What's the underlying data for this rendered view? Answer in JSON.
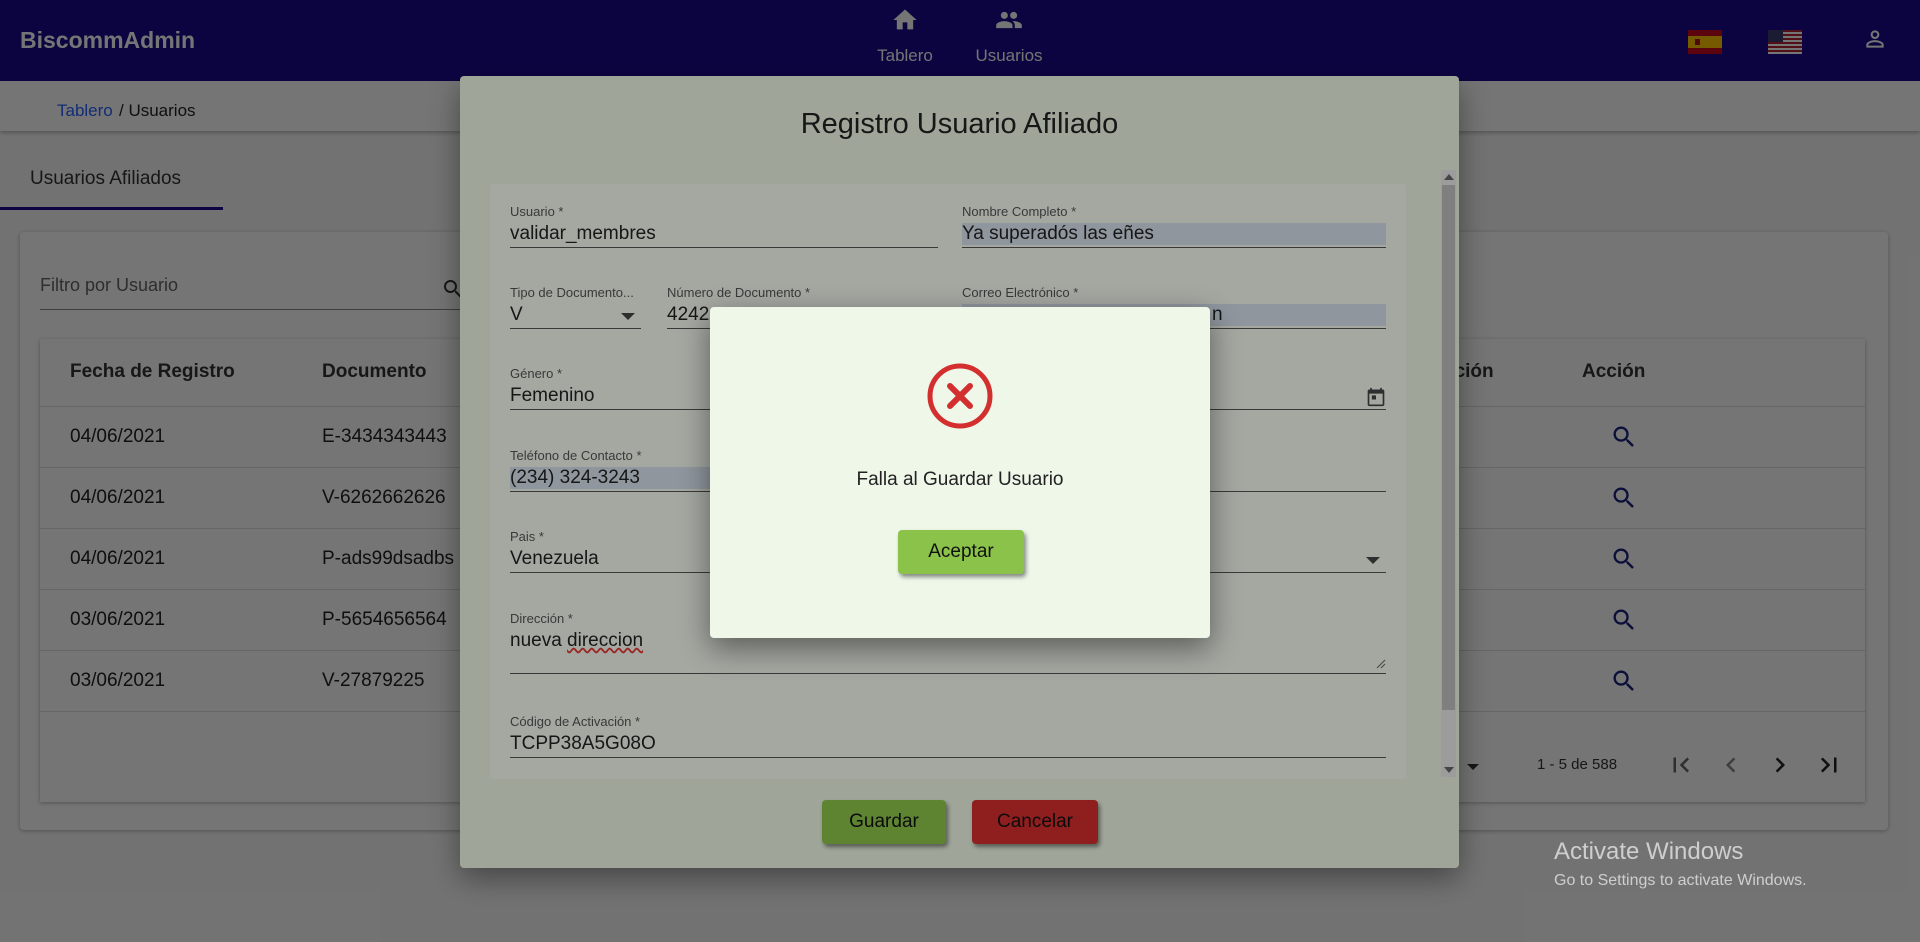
{
  "app": {
    "brand": "BiscommAdmin"
  },
  "nav": [
    {
      "label": "Tablero",
      "icon": "home-icon"
    },
    {
      "label": "Usuarios",
      "icon": "users-icon"
    }
  ],
  "header_icons": [
    "spain-flag-icon",
    "usa-flag-icon",
    "user-account-icon"
  ],
  "breadcrumb": {
    "link": "Tablero",
    "current": "/ Usuarios"
  },
  "tab": {
    "label": "Usuarios Afiliados"
  },
  "filter": {
    "placeholder": "Filtro por Usuario"
  },
  "table": {
    "columns": [
      "Fecha de Registro",
      "Documento",
      "ación",
      "Acción"
    ],
    "rows": [
      {
        "date": "04/06/2021",
        "doc": "E-3434343443"
      },
      {
        "date": "04/06/2021",
        "doc": "V-6262662626"
      },
      {
        "date": "04/06/2021",
        "doc": "P-ads99dsadbs"
      },
      {
        "date": "03/06/2021",
        "doc": "P-5654656564"
      },
      {
        "date": "03/06/2021",
        "doc": "V-27879225"
      }
    ],
    "pagination": "1 - 5 de 588"
  },
  "dialog": {
    "title": "Registro Usuario Afiliado",
    "fields": {
      "usuario": {
        "label": "Usuario *",
        "value": "validar_membres"
      },
      "nombre": {
        "label": "Nombre Completo *",
        "value": "Ya superadós las eñes"
      },
      "tipo_doc": {
        "label": "Tipo de Documento...",
        "value": "V"
      },
      "num_doc": {
        "label": "Número de Documento *",
        "value": "4242"
      },
      "correo": {
        "label": "Correo Electrónico *",
        "value": "n"
      },
      "genero": {
        "label": "Género *",
        "value": "Femenino"
      },
      "telefono": {
        "label": "Teléfono de Contacto *",
        "value": "(234) 324-3243"
      },
      "pais": {
        "label": "Pais *",
        "value": "Venezuela"
      },
      "direccion": {
        "label": "Dirección *",
        "value_plain": "nueva ",
        "value_spell": "direccion"
      },
      "codigo": {
        "label": "Código de Activación *",
        "value": "TCPP38A5G08O"
      }
    },
    "save_label": "Guardar",
    "cancel_label": "Cancelar"
  },
  "alert": {
    "message": "Falla al Guardar Usuario",
    "button_label": "Aceptar"
  },
  "watermark": {
    "title": "Activate Windows",
    "subtitle": "Go to Settings to activate Windows."
  },
  "colors": {
    "topbar": "#1c0b8f",
    "accent_link": "#2962ff",
    "success": "#8bc34a",
    "danger": "#d32f2f",
    "error_icon": "#d32f2f"
  }
}
